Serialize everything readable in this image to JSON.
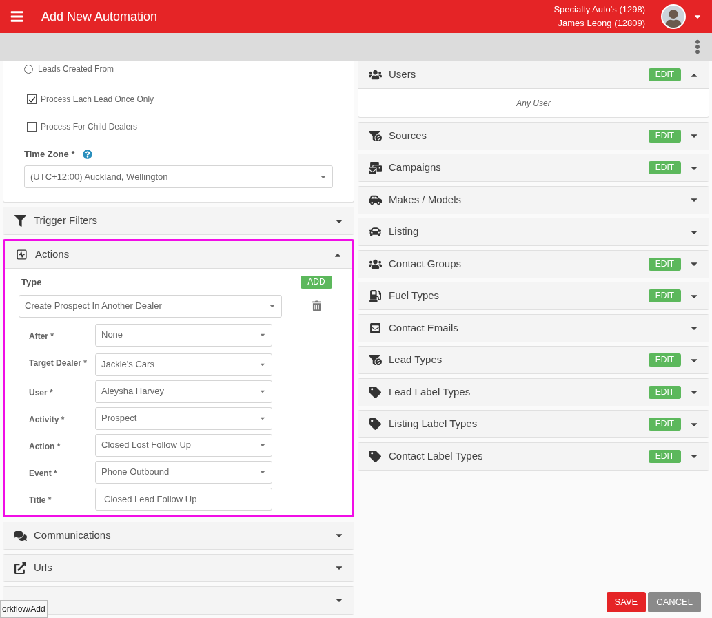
{
  "header": {
    "title": "Add New Automation",
    "dealer": "Specialty Auto's (1298)",
    "user": "James Leong (12809)"
  },
  "settings": {
    "options": [
      {
        "kind": "radio",
        "label": "Leads Created From",
        "checked": false
      },
      {
        "kind": "checkbox",
        "label": "Process Each Lead Once Only",
        "checked": true
      },
      {
        "kind": "checkbox",
        "label": "Process For Child Dealers",
        "checked": false
      }
    ],
    "time_zone": {
      "label": "Time Zone *",
      "value": "(UTC+12:00) Auckland, Wellington"
    }
  },
  "left_panels": [
    {
      "title": "Trigger Filters",
      "expanded": false,
      "highlighted": false
    },
    {
      "title": "Actions",
      "expanded": true,
      "highlighted": true
    },
    {
      "title": "Communications",
      "expanded": false,
      "highlighted": false
    },
    {
      "title": "Urls",
      "expanded": false,
      "highlighted": false
    },
    {
      "expanded": false,
      "highlighted": false
    }
  ],
  "actions": {
    "type_label": "Type",
    "add_button": "ADD",
    "type_value": "Create Prospect In Another Dealer",
    "fields": [
      {
        "kind": "select",
        "label": "After *",
        "value": "None"
      },
      {
        "kind": "select",
        "label": "Target Dealer *",
        "value": "Jackie's Cars"
      },
      {
        "kind": "select",
        "label": "User *",
        "value": "Aleysha Harvey"
      },
      {
        "kind": "select",
        "label": "Activity *",
        "value": "Prospect"
      },
      {
        "kind": "select",
        "label": "Action *",
        "value": "Closed Lost Follow Up"
      },
      {
        "kind": "select",
        "label": "Event *",
        "value": "Phone Outbound"
      },
      {
        "kind": "text",
        "label": "Title *",
        "value": "Closed Lead Follow Up"
      }
    ]
  },
  "right_panels": [
    {
      "title": "Users",
      "edit": "EDIT",
      "expanded": true,
      "body": "Any User"
    },
    {
      "title": "Sources",
      "edit": "EDIT",
      "expanded": false
    },
    {
      "title": "Campaigns",
      "edit": "EDIT",
      "expanded": false
    },
    {
      "title": "Makes / Models",
      "expanded": false
    },
    {
      "title": "Listing",
      "expanded": false
    },
    {
      "title": "Contact Groups",
      "edit": "EDIT",
      "expanded": false
    },
    {
      "title": "Fuel Types",
      "edit": "EDIT",
      "expanded": false
    },
    {
      "title": "Contact Emails",
      "expanded": false
    },
    {
      "title": "Lead Types",
      "edit": "EDIT",
      "expanded": false
    },
    {
      "title": "Lead Label Types",
      "edit": "EDIT",
      "expanded": false
    },
    {
      "title": "Listing Label Types",
      "edit": "EDIT",
      "expanded": false
    },
    {
      "title": "Contact Label Types",
      "edit": "EDIT",
      "expanded": false
    }
  ],
  "buttons": [
    {
      "kind": "primary",
      "label": "SAVE"
    },
    {
      "kind": "secondary",
      "label": "CANCEL"
    }
  ],
  "status_url": "orkflow/Add"
}
